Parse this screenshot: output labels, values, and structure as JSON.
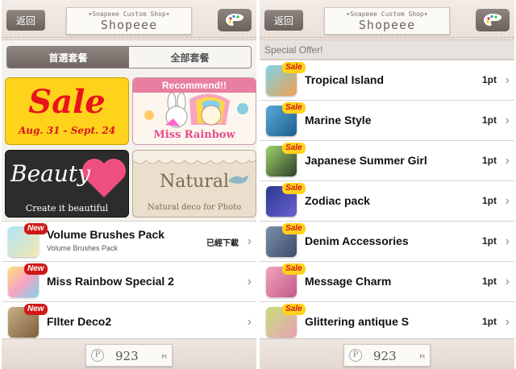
{
  "left": {
    "header": {
      "back_label": "返回",
      "logo_small": "▾Snapeee Custom Shop▾",
      "logo_big": "Shopeee"
    },
    "tabs": [
      {
        "label": "首選套餐",
        "active": true
      },
      {
        "label": "全部套餐",
        "active": false
      }
    ],
    "banners": {
      "sale": {
        "title": "Sale",
        "dates": "Aug. 31 - Sept. 24"
      },
      "recommend": {
        "header": "Recommend!!",
        "caption": "Miss Rainbow"
      },
      "beauty": {
        "title": "Beauty",
        "caption": "Create it beautiful"
      },
      "natural": {
        "title": "Natural",
        "caption": "Natural deco for Photo"
      }
    },
    "items": [
      {
        "badge": "New",
        "title": "Volume Brushes Pack",
        "subtitle": "Volume Brushes Pack",
        "status": "已經下載"
      },
      {
        "badge": "New",
        "title": "Miss Rainbow Special 2"
      },
      {
        "badge": "New",
        "title": "FIlter Deco2"
      }
    ],
    "footer": {
      "symbol": "P",
      "points": "923",
      "unit": "Pt"
    }
  },
  "right": {
    "header": {
      "back_label": "返回",
      "logo_small": "▾Snapeee Custom Shop▾",
      "logo_big": "Shopeee"
    },
    "section_title": "Special Offer!",
    "items": [
      {
        "badge": "Sale",
        "title": "Tropical Island",
        "price": "1pt"
      },
      {
        "badge": "Sale",
        "title": "Marine Style",
        "price": "1pt"
      },
      {
        "badge": "Sale",
        "title": "Japanese Summer Girl",
        "price": "1pt"
      },
      {
        "badge": "Sale",
        "title": "Zodiac pack",
        "price": "1pt"
      },
      {
        "badge": "Sale",
        "title": "Denim Accessories",
        "price": "1pt"
      },
      {
        "badge": "Sale",
        "title": "Message Charm",
        "price": "1pt"
      },
      {
        "badge": "Sale",
        "title": "Glittering antique S",
        "price": "1pt"
      }
    ],
    "footer": {
      "symbol": "P",
      "points": "923",
      "unit": "Pt"
    }
  },
  "colors": {
    "accent_brown": "#7a716c",
    "sale_red": "#d11818",
    "sale_yellow": "#ffd21b",
    "recommend_pink": "#e97fa0"
  },
  "icons": {
    "back": "back-arrow-icon",
    "palette": "palette-icon",
    "chevron": "chevron-right-icon",
    "points": "points-coin-icon"
  }
}
